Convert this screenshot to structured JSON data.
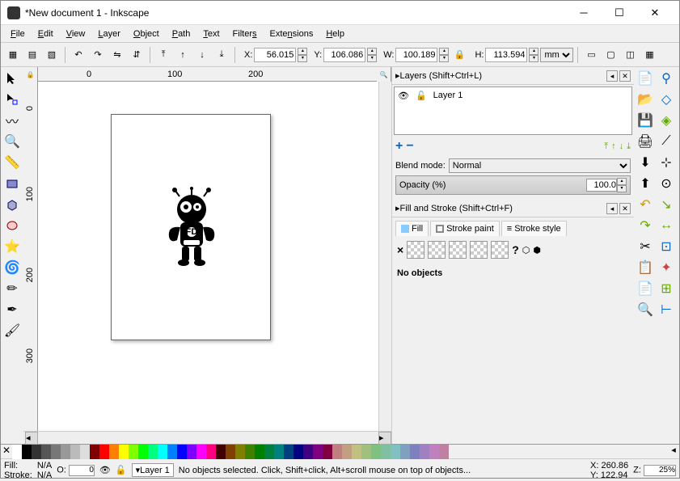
{
  "window": {
    "title": "*New document 1 - Inkscape"
  },
  "menu": {
    "file": "File",
    "edit": "Edit",
    "view": "View",
    "layer": "Layer",
    "object": "Object",
    "path": "Path",
    "text": "Text",
    "filters": "Filters",
    "extensions": "Extensions",
    "help": "Help"
  },
  "coords": {
    "x_label": "X:",
    "x": "56.015",
    "y_label": "Y:",
    "y": "106.086",
    "w_label": "W:",
    "w": "100.189",
    "h_label": "H:",
    "h": "113.594",
    "unit": "mm"
  },
  "ruler": {
    "h0": "0",
    "h100": "100",
    "h200": "200",
    "v0": "0",
    "v100": "100",
    "v200": "200",
    "v300": "300"
  },
  "layers_panel": {
    "title": "Layers (Shift+Ctrl+L)",
    "item": "Layer 1",
    "blend_label": "Blend mode:",
    "blend": "Normal",
    "opacity_label": "Opacity (%)",
    "opacity": "100.0"
  },
  "fill_panel": {
    "title": "Fill and Stroke (Shift+Ctrl+F)",
    "tab_fill": "Fill",
    "tab_stroke": "Stroke paint",
    "tab_style": "Stroke style",
    "noobj": "No objects"
  },
  "palette_colors": [
    "#fff",
    "#000",
    "#333",
    "#555",
    "#777",
    "#999",
    "#bbb",
    "#ddd",
    "#800000",
    "#f00",
    "#ff8000",
    "#ff0",
    "#80ff00",
    "#0f0",
    "#00ff80",
    "#0ff",
    "#0080ff",
    "#00f",
    "#8000ff",
    "#f0f",
    "#ff0080",
    "#400000",
    "#804000",
    "#808000",
    "#408000",
    "#008000",
    "#008040",
    "#008080",
    "#004080",
    "#000080",
    "#400080",
    "#800080",
    "#800040",
    "#c08080",
    "#c0a080",
    "#c0c080",
    "#a0c080",
    "#80c080",
    "#80c0a0",
    "#80c0c0",
    "#80a0c0",
    "#8080c0",
    "#a080c0",
    "#c080c0",
    "#c080a0"
  ],
  "status": {
    "fill_label": "Fill:",
    "fill": "N/A",
    "stroke_label": "Stroke:",
    "stroke": "N/A",
    "o_label": "O:",
    "o": "0",
    "layer": "Layer 1",
    "msg": "No objects selected. Click, Shift+click, Alt+scroll mouse on top of objects...",
    "xlabel": "X:",
    "x": "260.86",
    "ylabel": "Y:",
    "y": "122.94",
    "zlabel": "Z:",
    "z": "25%"
  }
}
